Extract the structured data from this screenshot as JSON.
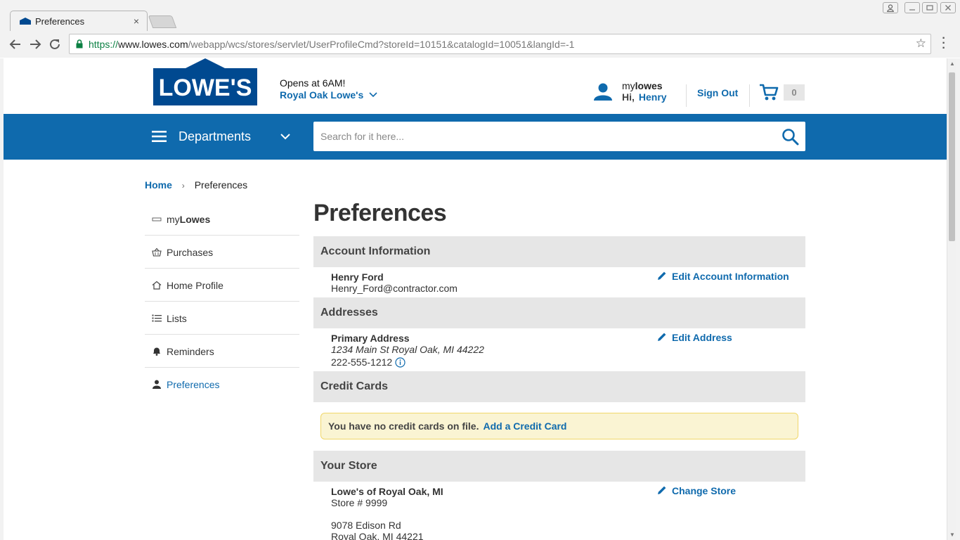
{
  "browser": {
    "tab_title": "Preferences",
    "tab_close": "×",
    "url_scheme": "https://",
    "url_host": "www.lowes.com",
    "url_path": "/webapp/wcs/stores/servlet/UserProfileCmd?storeId=10151&catalogId=10051&langId=-1"
  },
  "header": {
    "logo_text": "LOWE'S",
    "store_hours": "Opens at 6AM!",
    "store_name": "Royal Oak Lowe's",
    "mylowes_prefix": "my",
    "mylowes_bold": "lowes",
    "greeting": "Hi,",
    "user_name": "Henry",
    "sign_out": "Sign Out",
    "cart_count": "0"
  },
  "nav": {
    "departments": "Departments",
    "search_placeholder": "Search for it here..."
  },
  "breadcrumb": {
    "home": "Home",
    "separator": "›",
    "current": "Preferences"
  },
  "sidebar": {
    "items": [
      {
        "prefix": "my",
        "bold": "Lowes",
        "icon": "mylowes-card-icon"
      },
      {
        "label": "Purchases",
        "icon": "basket-icon"
      },
      {
        "label": "Home Profile",
        "icon": "house-icon"
      },
      {
        "label": "Lists",
        "icon": "list-icon"
      },
      {
        "label": "Reminders",
        "icon": "bell-icon"
      },
      {
        "label": "Preferences",
        "icon": "person-icon"
      }
    ]
  },
  "main": {
    "title": "Preferences",
    "account": {
      "heading": "Account Information",
      "name": "Henry Ford",
      "email": "Henry_Ford@contractor.com",
      "edit": "Edit Account Information"
    },
    "addresses": {
      "heading": "Addresses",
      "label": "Primary Address",
      "address": "1234 Main St Royal Oak, MI 44222",
      "phone": "222-555-1212",
      "edit": "Edit Address"
    },
    "credit_cards": {
      "heading": "Credit Cards",
      "notice": "You have no credit cards on file.",
      "add_link": "Add a Credit Card"
    },
    "store": {
      "heading": "Your Store",
      "name": "Lowe's of Royal Oak, MI",
      "number": "Store # 9999",
      "street": "9078 Edison Rd",
      "city": "Royal Oak, MI 44221",
      "change": "Change Store"
    }
  },
  "colors": {
    "brand_blue": "#0f6aad",
    "logo_blue": "#004990",
    "section_bg": "#e6e6e6",
    "notice_bg": "#faf4d3"
  }
}
